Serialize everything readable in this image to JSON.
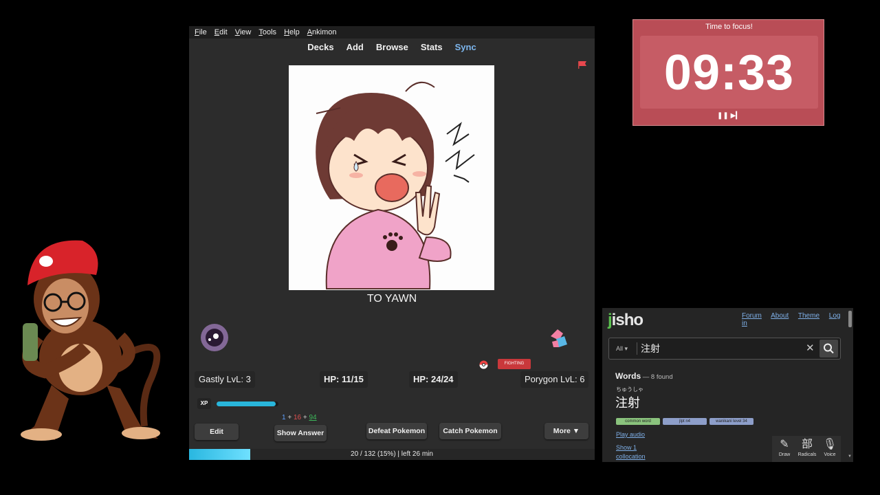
{
  "anki": {
    "menu": [
      "File",
      "Edit",
      "View",
      "Tools",
      "Help",
      "Ankimon"
    ],
    "toolbar": [
      "Decks",
      "Add",
      "Browse",
      "Stats",
      "Sync"
    ],
    "card_word": "TO YAWN",
    "player_pokemon": "Gastly LvL: 3",
    "player_hp": "HP: 11/15",
    "enemy_hp": "HP: 24/24",
    "enemy_pokemon": "Porygon LvL: 6",
    "enemy_type": "FIGHTING",
    "xp_label": "XP",
    "xp_fraction": 0.95,
    "counts": {
      "new": "1",
      "learn": "16",
      "review": "94",
      "plus": "+"
    },
    "buttons": {
      "edit": "Edit",
      "show_answer": "Show Answer",
      "defeat": "Defeat Pokemon",
      "catch": "Catch Pokemon",
      "more": "More ▼"
    },
    "progress_text": "20 / 132 (15%) | left 26 min",
    "progress_fraction": 0.15,
    "icons": {
      "flag": "flag-icon",
      "pokeball": "pokeball-icon"
    }
  },
  "timer": {
    "title": "Time to focus!",
    "time": "09:33",
    "controls": "❚❚ ▶▎",
    "bg_color": "#b94d56"
  },
  "jisho": {
    "logo_prefix": "j",
    "logo_rest": "isho",
    "nav": [
      "Forum",
      "About",
      "Theme",
      "Log in"
    ],
    "scope": "All ▾",
    "query": "注射",
    "clear": "✕",
    "words_label": "Words",
    "found": " — 8 found",
    "furigana": "ちゅうしゃ",
    "kanji": "注射",
    "tags": [
      "common word",
      "jlpt n4",
      "wanikani level 34"
    ],
    "play_audio": "Play audio",
    "show_collocation": "Show 1 collocation",
    "tools": [
      {
        "icon": "✎",
        "label": "Draw"
      },
      {
        "icon": "部",
        "label": "Radicals"
      },
      {
        "icon": "🎙",
        "label": "Voice"
      }
    ]
  }
}
